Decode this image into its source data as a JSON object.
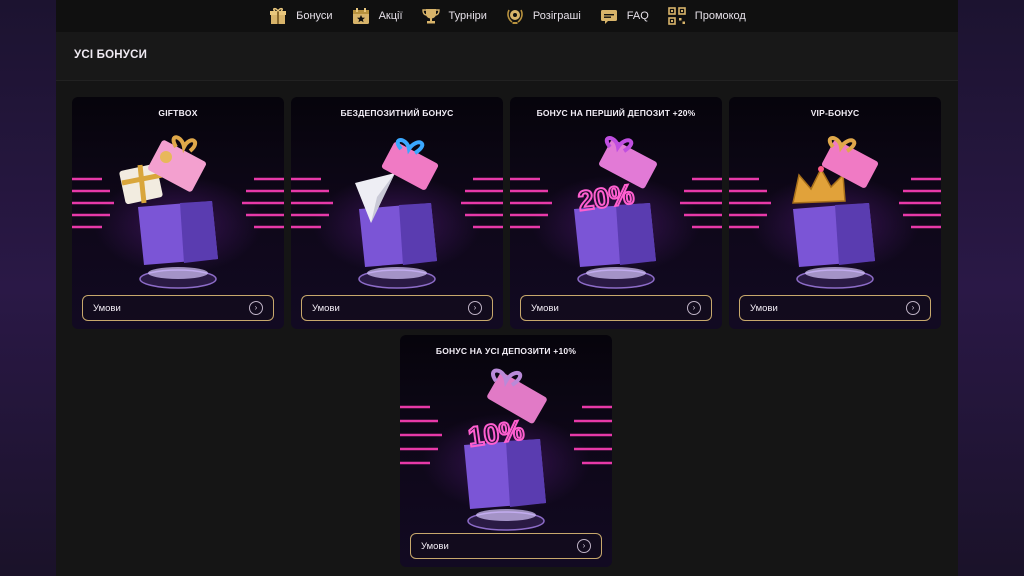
{
  "nav": {
    "items": [
      {
        "label": "Бонуси",
        "icon": "gift-icon"
      },
      {
        "label": "Акції",
        "icon": "calendar-star-icon"
      },
      {
        "label": "Турніри",
        "icon": "trophy-icon"
      },
      {
        "label": "Розіграші",
        "icon": "laurel-badge-icon"
      },
      {
        "label": "FAQ",
        "icon": "faq-icon"
      },
      {
        "label": "Промокод",
        "icon": "qr-code-icon"
      }
    ]
  },
  "section": {
    "title": "УСІ БОНУСИ"
  },
  "cards": [
    {
      "title": "GIFTBOX",
      "button": "Умови",
      "badge": ""
    },
    {
      "title": "БЕЗДЕПОЗИТНИЙ БОНУС",
      "button": "Умови",
      "badge": ""
    },
    {
      "title": "БОНУС НА ПЕРШИЙ ДЕПОЗИТ +20%",
      "button": "Умови",
      "badge": "20%"
    },
    {
      "title": "VIP-БОНУС",
      "button": "Умови",
      "badge": ""
    },
    {
      "title": "БОНУС НА УСІ ДЕПОЗИТИ +10%",
      "button": "Умови",
      "badge": "10%"
    }
  ],
  "colors": {
    "accent_gold": "#c7a86c",
    "neon_pink": "#ff3fb8",
    "box_purple": "#8b5cf6"
  }
}
